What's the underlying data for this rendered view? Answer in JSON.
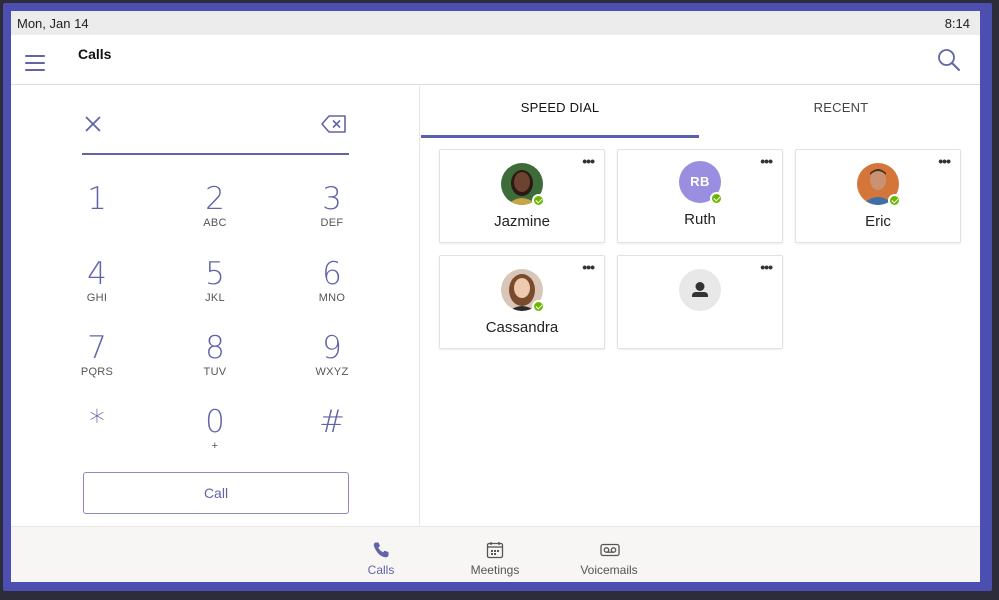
{
  "status_bar": {
    "date": "Mon, Jan 14",
    "time": "8:14"
  },
  "app_bar": {
    "title": "Calls"
  },
  "dialpad": {
    "keys": [
      {
        "digit": "1",
        "letters": ""
      },
      {
        "digit": "2",
        "letters": "ABC"
      },
      {
        "digit": "3",
        "letters": "DEF"
      },
      {
        "digit": "4",
        "letters": "GHI"
      },
      {
        "digit": "5",
        "letters": "JKL"
      },
      {
        "digit": "6",
        "letters": "MNO"
      },
      {
        "digit": "7",
        "letters": "PQRS"
      },
      {
        "digit": "8",
        "letters": "TUV"
      },
      {
        "digit": "9",
        "letters": "WXYZ"
      },
      {
        "digit": "*",
        "letters": ""
      },
      {
        "digit": "0",
        "letters": "+"
      },
      {
        "digit": "#",
        "letters": ""
      }
    ],
    "call_label": "Call"
  },
  "tabs": [
    {
      "label": "SPEED DIAL",
      "active": true
    },
    {
      "label": "RECENT",
      "active": false
    }
  ],
  "speed_dial": [
    {
      "name": "Jazmine",
      "initials": "",
      "presence": "available"
    },
    {
      "name": "Ruth",
      "initials": "RB",
      "presence": "available"
    },
    {
      "name": "Eric",
      "initials": "",
      "presence": "available"
    },
    {
      "name": "Cassandra",
      "initials": "",
      "presence": "available"
    },
    {
      "name": "",
      "initials": "",
      "presence": ""
    }
  ],
  "more_label": "•••",
  "bottom_nav": [
    {
      "label": "Calls",
      "icon": "phone-icon",
      "active": true
    },
    {
      "label": "Meetings",
      "icon": "calendar-icon",
      "active": false
    },
    {
      "label": "Voicemails",
      "icon": "voicemail-icon",
      "active": false
    }
  ],
  "colors": {
    "accent": "#6264a7",
    "presence": "#6bb700",
    "frame": "#4d4fb0"
  }
}
